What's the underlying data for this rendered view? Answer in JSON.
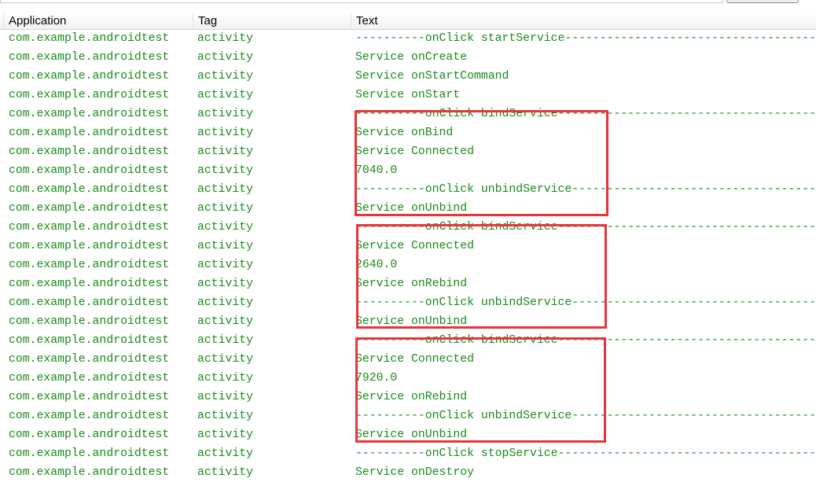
{
  "columns": [
    "Application",
    "Tag",
    "Text"
  ],
  "colors": {
    "text": "#1a8a1a",
    "highlight": "#e8343a"
  },
  "rows": [
    {
      "app": "com.example.androidtest",
      "tag": "activity",
      "text": "----------onClick startService----------------------------------------------"
    },
    {
      "app": "com.example.androidtest",
      "tag": "activity",
      "text": "Service onCreate"
    },
    {
      "app": "com.example.androidtest",
      "tag": "activity",
      "text": "Service onStartCommand"
    },
    {
      "app": "com.example.androidtest",
      "tag": "activity",
      "text": "Service onStart"
    },
    {
      "app": "com.example.androidtest",
      "tag": "activity",
      "text": "----------onClick bindService-----------------------------------------------"
    },
    {
      "app": "com.example.androidtest",
      "tag": "activity",
      "text": "Service onBind"
    },
    {
      "app": "com.example.androidtest",
      "tag": "activity",
      "text": "Service Connected"
    },
    {
      "app": "com.example.androidtest",
      "tag": "activity",
      "text": "7040.0"
    },
    {
      "app": "com.example.androidtest",
      "tag": "activity",
      "text": "----------onClick unbindService---------------------------------------------"
    },
    {
      "app": "com.example.androidtest",
      "tag": "activity",
      "text": "Service onUnbind"
    },
    {
      "app": "com.example.androidtest",
      "tag": "activity",
      "text": "----------onClick bindService-----------------------------------------------"
    },
    {
      "app": "com.example.androidtest",
      "tag": "activity",
      "text": "Service Connected"
    },
    {
      "app": "com.example.androidtest",
      "tag": "activity",
      "text": "2640.0"
    },
    {
      "app": "com.example.androidtest",
      "tag": "activity",
      "text": "Service onRebind"
    },
    {
      "app": "com.example.androidtest",
      "tag": "activity",
      "text": "----------onClick unbindService---------------------------------------------"
    },
    {
      "app": "com.example.androidtest",
      "tag": "activity",
      "text": "Service onUnbind"
    },
    {
      "app": "com.example.androidtest",
      "tag": "activity",
      "text": "----------onClick bindService-----------------------------------------------"
    },
    {
      "app": "com.example.androidtest",
      "tag": "activity",
      "text": "Service Connected"
    },
    {
      "app": "com.example.androidtest",
      "tag": "activity",
      "text": "7920.0"
    },
    {
      "app": "com.example.androidtest",
      "tag": "activity",
      "text": "Service onRebind"
    },
    {
      "app": "com.example.androidtest",
      "tag": "activity",
      "text": "----------onClick unbindService---------------------------------------------"
    },
    {
      "app": "com.example.androidtest",
      "tag": "activity",
      "text": "Service onUnbind"
    },
    {
      "app": "com.example.androidtest",
      "tag": "activity",
      "text": "----------onClick stopService-----------------------------------------------"
    },
    {
      "app": "com.example.androidtest",
      "tag": "activity",
      "text": "Service onDestroy"
    }
  ]
}
